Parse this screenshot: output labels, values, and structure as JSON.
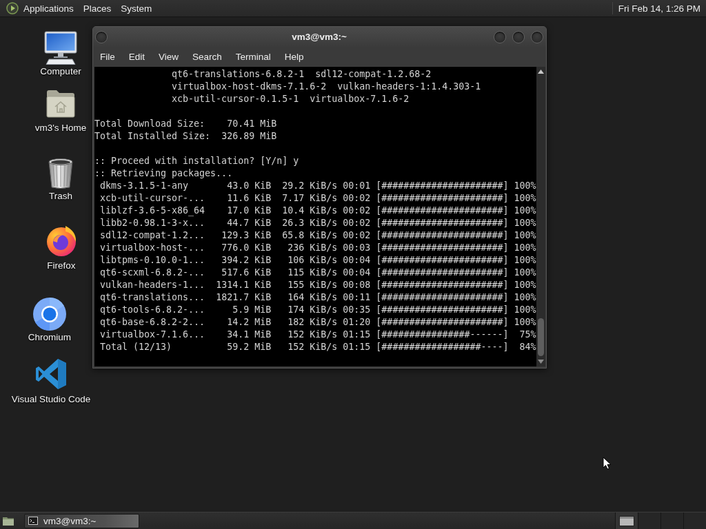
{
  "top_panel": {
    "menus": [
      "Applications",
      "Places",
      "System"
    ],
    "clock": "Fri Feb 14, 1:26 PM"
  },
  "desktop_icons": [
    {
      "label": "Computer",
      "kind": "monitor"
    },
    {
      "label": "vm3's Home",
      "kind": "folder"
    },
    {
      "label": "Trash",
      "kind": "trash"
    },
    {
      "label": "Firefox",
      "kind": "flame"
    },
    {
      "label": "Chromium",
      "kind": "ring"
    },
    {
      "label": "Visual Studio Code",
      "kind": "ribbon"
    }
  ],
  "window": {
    "title": "vm3@vm3:~",
    "menu": [
      "File",
      "Edit",
      "View",
      "Search",
      "Terminal",
      "Help"
    ],
    "terminal": {
      "package_lines": [
        [
          "qt6-translations-6.8.2-1",
          "sdl12-compat-1.2.68-2"
        ],
        [
          "virtualbox-host-dkms-7.1.6-2",
          "vulkan-headers-1:1.4.303-1"
        ],
        [
          "xcb-util-cursor-0.1.5-1",
          "virtualbox-7.1.6-2"
        ]
      ],
      "sizes": [
        {
          "label": "Total Download Size:",
          "value": "70.41 MiB"
        },
        {
          "label": "Total Installed Size:",
          "value": "326.89 MiB"
        }
      ],
      "prompt": ":: Proceed with installation? [Y/n]",
      "answer": "y",
      "status": ":: Retrieving packages...",
      "downloads": [
        {
          "name": "dkms-3.1.5-1-any",
          "size": "43.0 KiB",
          "rate": "29.2 KiB/s",
          "time": "00:01",
          "bar": "[######################]",
          "percent": "100%"
        },
        {
          "name": "xcb-util-cursor-...",
          "size": "11.6 KiB",
          "rate": "7.17 KiB/s",
          "time": "00:02",
          "bar": "[######################]",
          "percent": "100%"
        },
        {
          "name": "liblzf-3.6-5-x86_64",
          "size": "17.0 KiB",
          "rate": "10.4 KiB/s",
          "time": "00:02",
          "bar": "[######################]",
          "percent": "100%"
        },
        {
          "name": "libb2-0.98.1-3-x...",
          "size": "44.7 KiB",
          "rate": "26.3 KiB/s",
          "time": "00:02",
          "bar": "[######################]",
          "percent": "100%"
        },
        {
          "name": "sdl12-compat-1.2...",
          "size": "129.3 KiB",
          "rate": "65.8 KiB/s",
          "time": "00:02",
          "bar": "[######################]",
          "percent": "100%"
        },
        {
          "name": "virtualbox-host-...",
          "size": "776.0 KiB",
          "rate": "236 KiB/s",
          "time": "00:03",
          "bar": "[######################]",
          "percent": "100%"
        },
        {
          "name": "libtpms-0.10.0-1...",
          "size": "394.2 KiB",
          "rate": "106 KiB/s",
          "time": "00:04",
          "bar": "[######################]",
          "percent": "100%"
        },
        {
          "name": "qt6-scxml-6.8.2-...",
          "size": "517.6 KiB",
          "rate": "115 KiB/s",
          "time": "00:04",
          "bar": "[######################]",
          "percent": "100%"
        },
        {
          "name": "vulkan-headers-1...",
          "size": "1314.1 KiB",
          "rate": "155 KiB/s",
          "time": "00:08",
          "bar": "[######################]",
          "percent": "100%"
        },
        {
          "name": "qt6-translations...",
          "size": "1821.7 KiB",
          "rate": "164 KiB/s",
          "time": "00:11",
          "bar": "[######################]",
          "percent": "100%"
        },
        {
          "name": "qt6-tools-6.8.2-...",
          "size": "5.9 MiB",
          "rate": "174 KiB/s",
          "time": "00:35",
          "bar": "[######################]",
          "percent": "100%"
        },
        {
          "name": "qt6-base-6.8.2-2...",
          "size": "14.2 MiB",
          "rate": "182 KiB/s",
          "time": "01:20",
          "bar": "[######################]",
          "percent": "100%"
        },
        {
          "name": "virtualbox-7.1.6...",
          "size": "34.1 MiB",
          "rate": "152 KiB/s",
          "time": "01:15",
          "bar": "[################------]",
          "percent": "75%"
        }
      ],
      "total": {
        "name": "Total (12/13)",
        "size": "59.2 MiB",
        "rate": "152 KiB/s",
        "time": "01:15",
        "bar": "[##################----]",
        "percent": "84%"
      }
    }
  },
  "bottom_panel": {
    "tasks": [
      "vm3@vm3:~"
    ],
    "workspaces": [
      {
        "selected": true,
        "has_window": true
      },
      {
        "selected": false,
        "has_window": false
      },
      {
        "selected": false,
        "has_window": false
      },
      {
        "selected": false,
        "has_window": false
      }
    ]
  }
}
